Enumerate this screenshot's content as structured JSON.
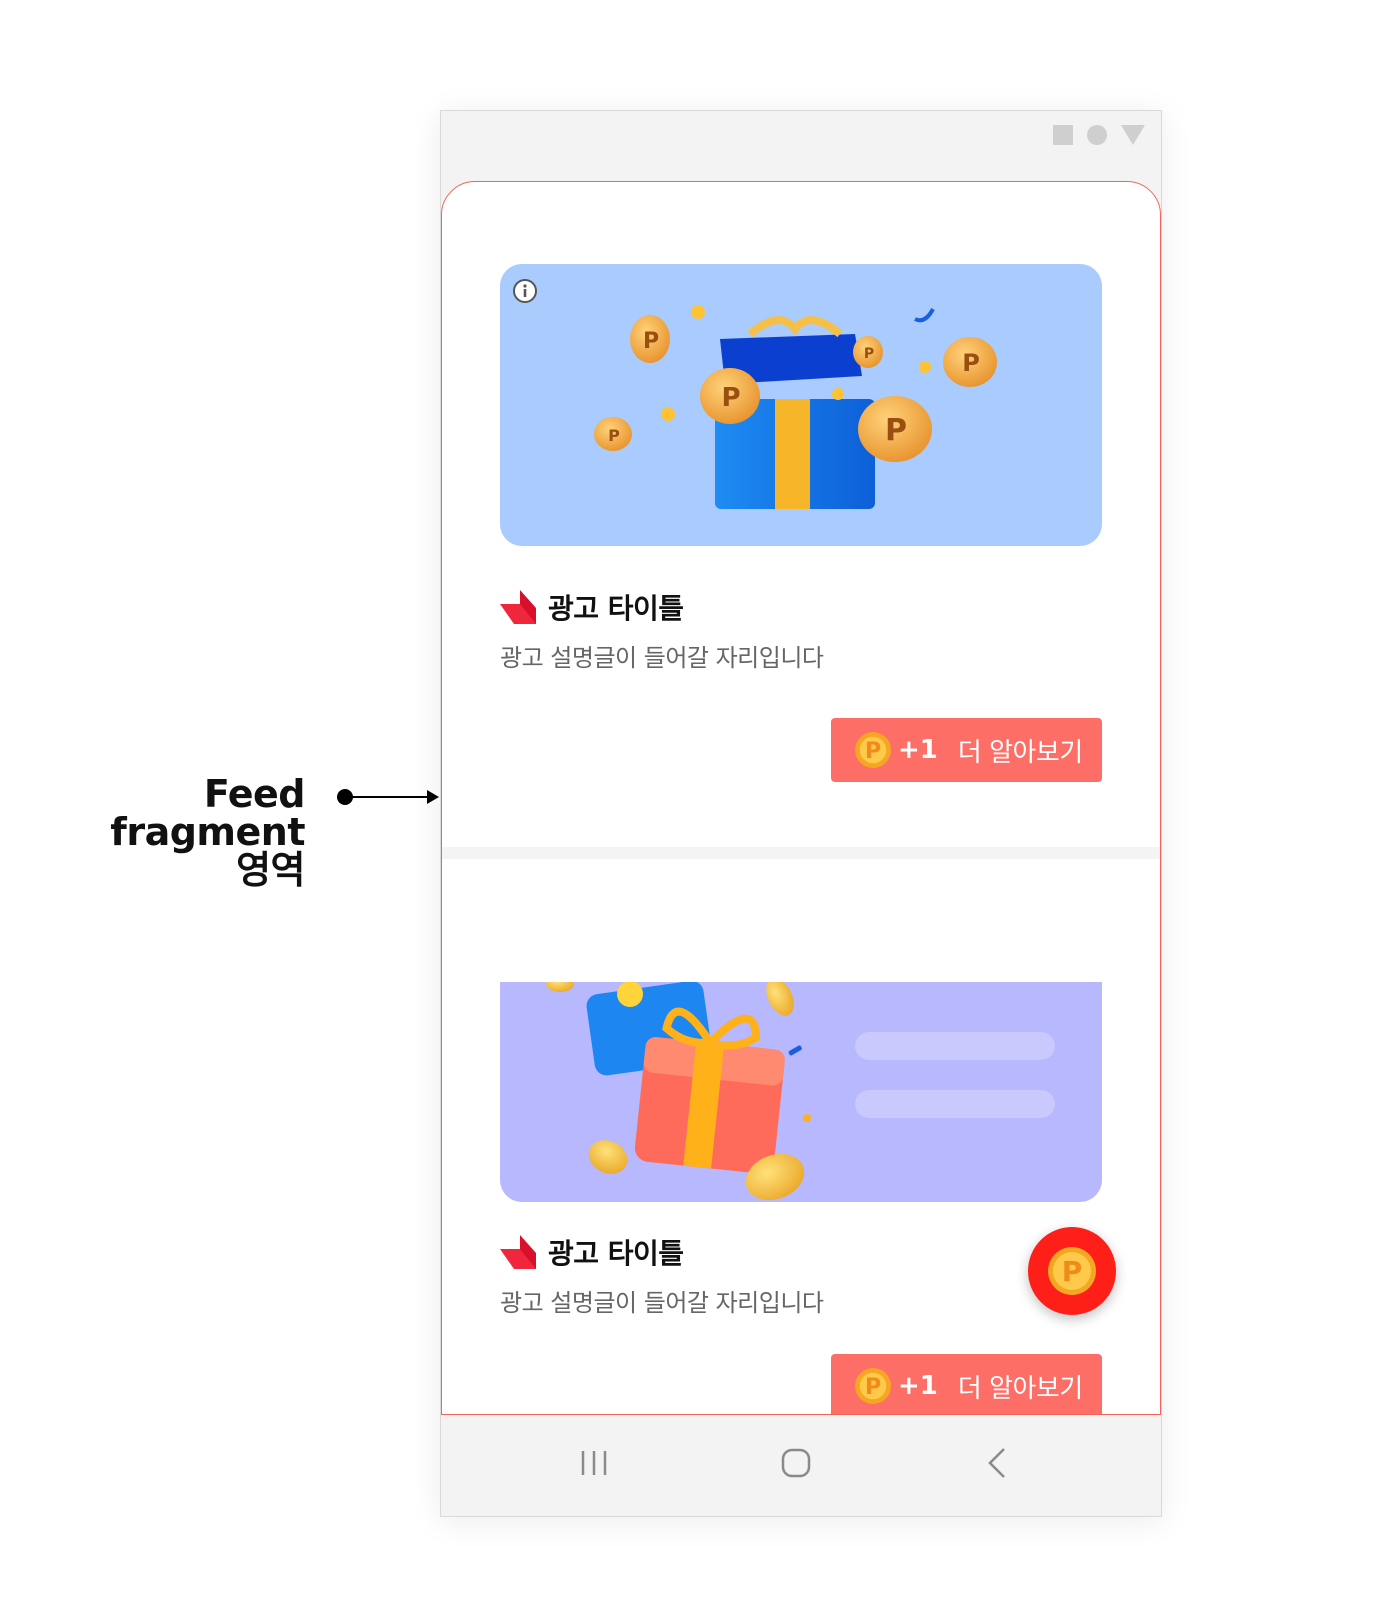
{
  "annotation": {
    "line1": "Feed fragment",
    "line2": "영역"
  },
  "status_bar": {
    "icons": [
      "square-icon",
      "circle-icon",
      "triangle-icon"
    ]
  },
  "feed": {
    "cards": [
      {
        "title": "광고 타이틀",
        "description": "광고 설명글이 들어갈 자리입니다",
        "reward": "+1",
        "cta_label": "더 알아보기",
        "banner_color": "#a9cbfd"
      },
      {
        "title": "광고 타이틀",
        "description": "광고 설명글이 들어갈 자리입니다",
        "reward": "+1",
        "cta_label": "더 알아보기",
        "banner_color": "#b7b8fd"
      }
    ]
  },
  "colors": {
    "accent": "#fd6e67",
    "fab": "#fe2018",
    "feed_border": "#f0645a",
    "coin": "#f5b63a"
  },
  "navbar": {
    "icons": [
      "recent-apps-icon",
      "home-icon",
      "back-icon"
    ]
  }
}
